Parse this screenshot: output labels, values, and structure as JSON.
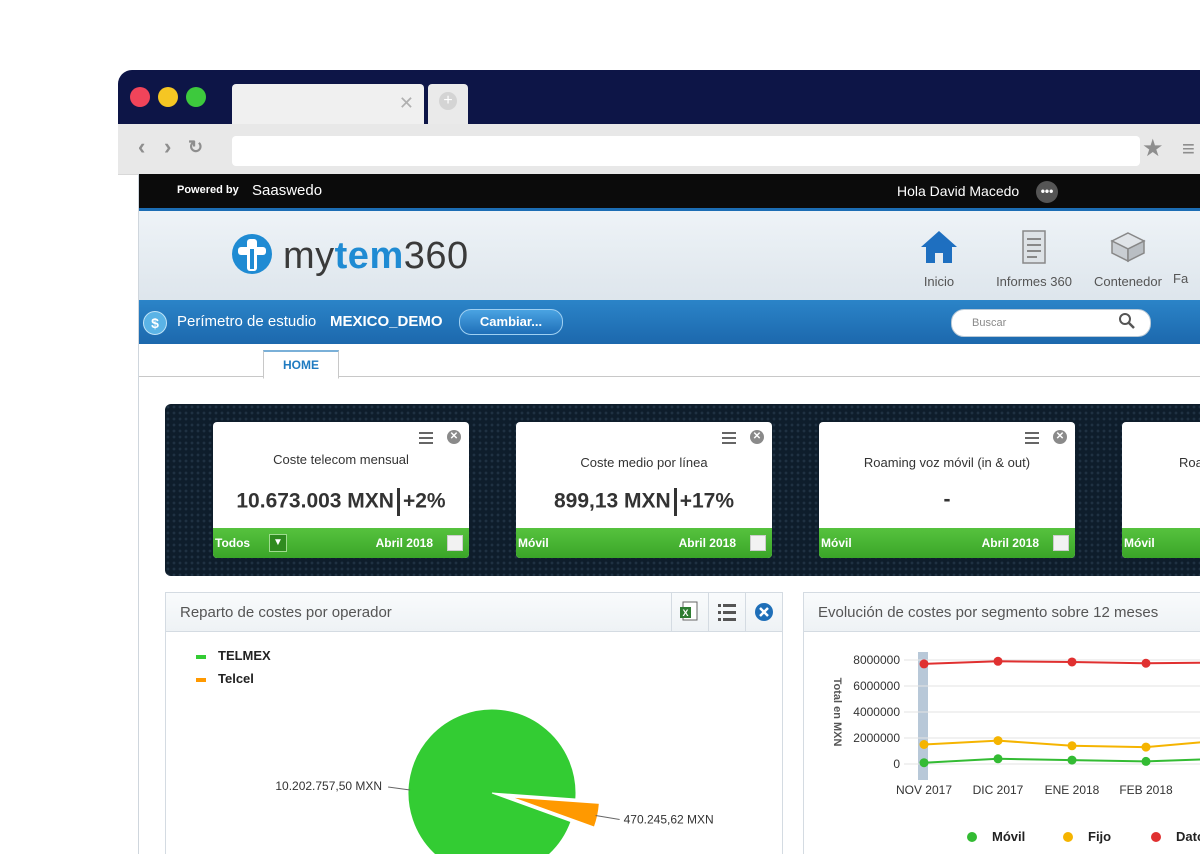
{
  "app": {
    "powered_by": "Powered by",
    "brand_saas": "Saaswedo",
    "greeting": "Hola David Macedo",
    "logo_light": "my",
    "logo_bold": "tem",
    "logo_tail": "360",
    "nav": [
      {
        "label": "Inicio",
        "icon": "home-icon"
      },
      {
        "label": "Informes 360",
        "icon": "report-icon"
      },
      {
        "label": "Contenedor",
        "icon": "container-icon"
      },
      {
        "label": "Fa",
        "icon": "truncated-icon"
      }
    ],
    "perimeter_label": "Perímetro de estudio",
    "perimeter_value": "MEXICO_DEMO",
    "change_button": "Cambiar...",
    "search_placeholder": "Buscar",
    "home_tab": "HOME"
  },
  "colors": {
    "accent_blue": "#1c6db4",
    "kpi_green": "#3aa528",
    "telmex": "#33cc33",
    "telcel": "#ff9900",
    "datos": "#e03030",
    "fijo": "#f5b400",
    "movil": "#33bb33"
  },
  "kpis": [
    {
      "title": "Coste telecom mensual",
      "value": "10.673.003 MXN",
      "delta": "+2%",
      "segment": "Todos",
      "month": "Abril 2018",
      "has_dropdown": true
    },
    {
      "title": "Coste medio por línea",
      "value": "899,13 MXN",
      "delta": "+17%",
      "segment": "Móvil",
      "month": "Abril 2018"
    },
    {
      "title": "Roaming voz móvil (in & out)",
      "value": "-",
      "delta": "",
      "segment": "Móvil",
      "month": "Abril 2018"
    },
    {
      "title": "Roa",
      "value": "",
      "delta": "",
      "segment": "Móvil",
      "month": ""
    }
  ],
  "panels": {
    "pie_title": "Reparto de costes por operador",
    "line_title": "Evolución de costes por segmento sobre 12 meses"
  },
  "chart_data": [
    {
      "type": "pie",
      "title": "Reparto de costes por operador",
      "slices": [
        {
          "name": "TELMEX",
          "value": 10202757.5,
          "label": "10.202.757,50 MXN"
        },
        {
          "name": "Telcel",
          "value": 470245.62,
          "label": "470.245,62 MXN"
        }
      ],
      "legend": "top-left"
    },
    {
      "type": "line",
      "title": "Evolución de costes por segmento sobre 12 meses",
      "ylabel": "Total en MXN",
      "categories": [
        "NOV 2017",
        "DIC 2017",
        "ENE 2018",
        "FEB 2018",
        "MA"
      ],
      "yticks": [
        0,
        2000000,
        4000000,
        6000000,
        8000000
      ],
      "ytick_labels": [
        "0",
        "2000000",
        "4000000",
        "6000000",
        "8000000"
      ],
      "ylim": [
        0,
        8000000
      ],
      "series": [
        {
          "name": "Móvil",
          "values": [
            100000,
            400000,
            300000,
            200000,
            400000
          ]
        },
        {
          "name": "Fijo",
          "values": [
            1500000,
            1800000,
            1400000,
            1300000,
            1800000
          ]
        },
        {
          "name": "Dato",
          "values": [
            7700000,
            7900000,
            7850000,
            7750000,
            7800000
          ]
        }
      ],
      "legend": "bottom",
      "grid": true
    }
  ]
}
